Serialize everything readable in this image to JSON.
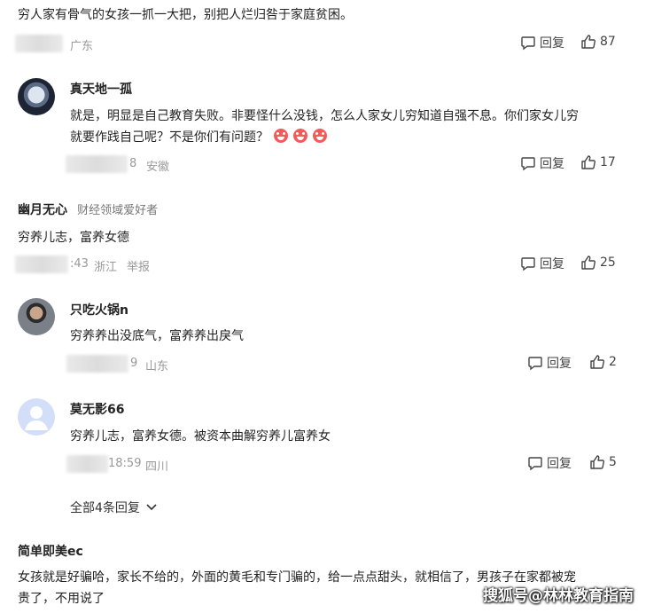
{
  "comments": [
    {
      "text": "穷人家有骨气的女孩一抓一大把，别把人烂归咎于家庭贫困。",
      "location": "广东",
      "reply_label": "回复",
      "likes": "87"
    },
    {
      "username": "真天地一孤",
      "text_lines": [
        "就是，明显是自己教育失败。非要怪什么没钱，怎么人家女儿穷知道自强不息。你们家女儿穷",
        "就要作践自己呢？不是你们有问题？"
      ],
      "time_suffix": "8",
      "location": "安徽",
      "reply_label": "回复",
      "likes": "17"
    },
    {
      "username": "幽月无心",
      "user_tag": "财经领域爱好者",
      "text": "穷养儿志，富养女德",
      "time_suffix": ":43",
      "location": "浙江",
      "report_label": "举报",
      "reply_label": "回复",
      "likes": "25"
    },
    {
      "username": "只吃火锅n",
      "text": "穷养养出没底气，富养养出戾气",
      "time_suffix": "9",
      "location": "山东",
      "reply_label": "回复",
      "likes": "2"
    },
    {
      "username": "莫无影66",
      "text": "穷养儿志，富养女德。被资本曲解穷养儿富养女",
      "time_suffix": "18:59",
      "location": "四川",
      "reply_label": "回复",
      "likes": "5"
    },
    {
      "username": "简单即美ec",
      "text_lines": [
        "女孩就是好骗哈，家长不给的，外面的黄毛和专门骗的，给一点点甜头，就相信了，男孩子在家都被宠",
        "贵了，不用说了"
      ]
    }
  ],
  "expand_replies": "全部4条回复",
  "watermark": "搜狐号@林林教育指南",
  "colors": {
    "text": "#222222",
    "meta": "#999999",
    "emoji": "#f35b5b"
  }
}
